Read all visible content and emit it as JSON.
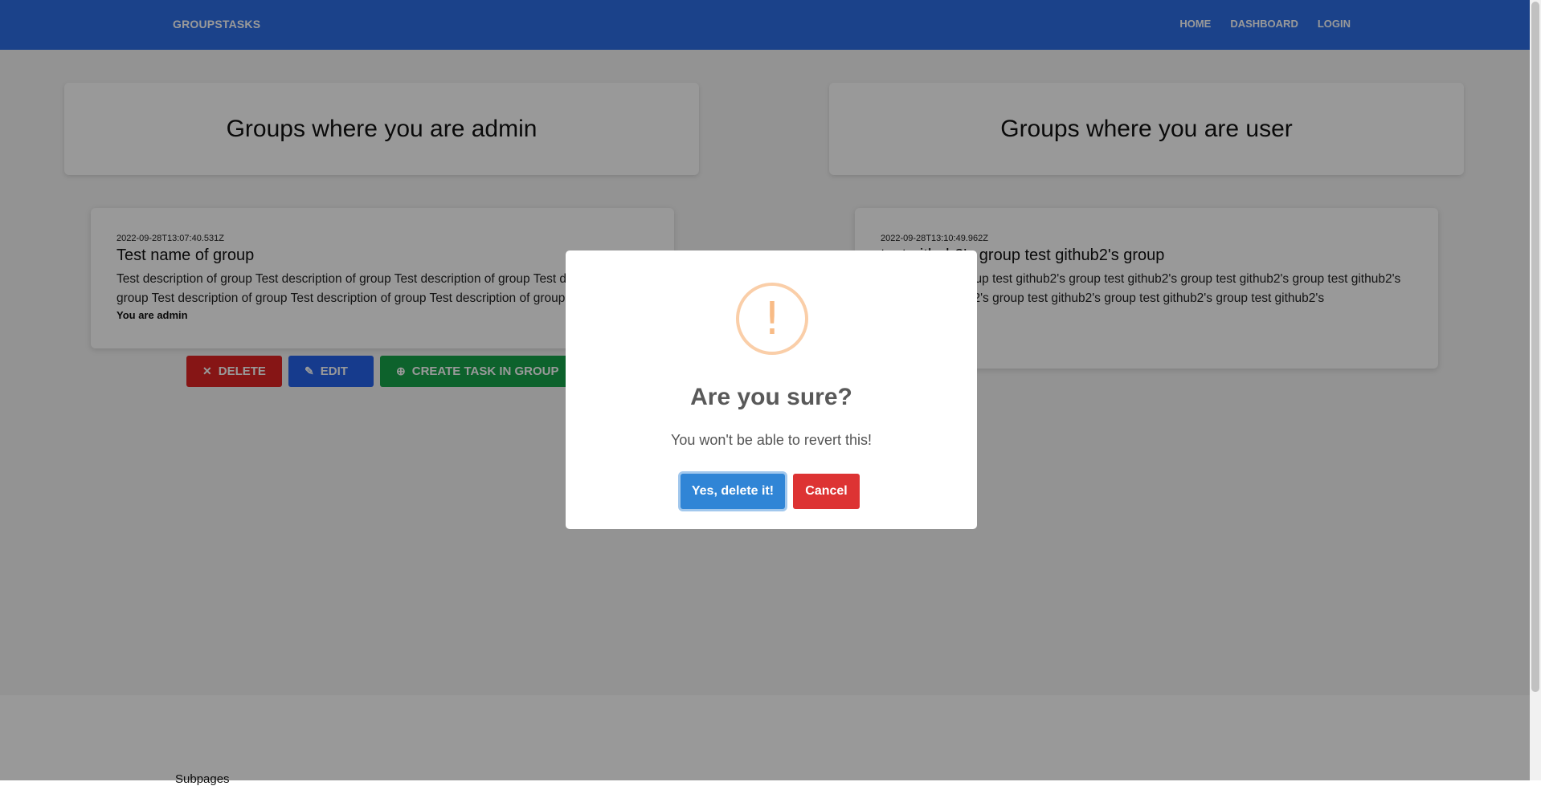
{
  "nav": {
    "brand": "GROUPSTASKS",
    "links": [
      "HOME",
      "DASHBOARD",
      "LOGIN"
    ]
  },
  "admin_section": {
    "title": "Groups where you are admin",
    "card": {
      "date": "2022-09-28T13:07:40.531Z",
      "name": "Test name of group",
      "description": "Test description of group Test description of group Test description of group Test description of group Test description of group Test description of group Test description of group",
      "role": "You are admin"
    },
    "actions": {
      "delete": "DELETE",
      "edit": "EDIT",
      "create_task": "CREATE TASK IN GROUP"
    }
  },
  "user_section": {
    "title": "Groups where you are user",
    "card": {
      "date": "2022-09-28T13:10:49.962Z",
      "name": "test github2's group test github2's group",
      "description": "test github2's group test github2's group test github2's group test github2's group test github2's group test github2's group test github2's group test github2's group test github2's"
    }
  },
  "footer": {
    "subpages": "Subpages"
  },
  "modal": {
    "icon": "!",
    "title": "Are you sure?",
    "message": "You won't be able to revert this!",
    "confirm": "Yes, delete it!",
    "cancel": "Cancel"
  }
}
